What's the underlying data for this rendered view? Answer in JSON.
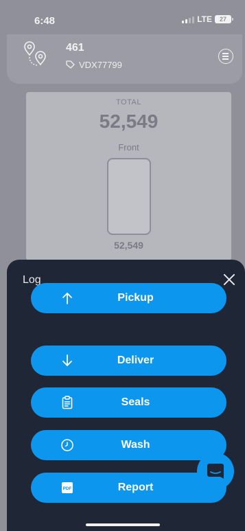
{
  "status_bar": {
    "time": "6:48",
    "network": "LTE",
    "battery": "27"
  },
  "header": {
    "number": "461",
    "tag": "VDX77799"
  },
  "total_card": {
    "label": "TOTAL",
    "value": "52,549",
    "compartment_label": "Front",
    "compartment_value": "52,549"
  },
  "sheet": {
    "title": "Log",
    "buttons": [
      {
        "label": "Pickup",
        "icon": "arrow-up-icon"
      },
      {
        "label": "Deliver",
        "icon": "arrow-down-icon"
      },
      {
        "label": "Seals",
        "icon": "clipboard-icon"
      },
      {
        "label": "Wash",
        "icon": "clock-icon"
      },
      {
        "label": "Report",
        "icon": "pdf-icon",
        "icon_text": "PDF"
      }
    ]
  },
  "colors": {
    "accent": "#0d96ee",
    "sheet_bg": "#1f2636",
    "dim_bg": "#8f9099"
  }
}
